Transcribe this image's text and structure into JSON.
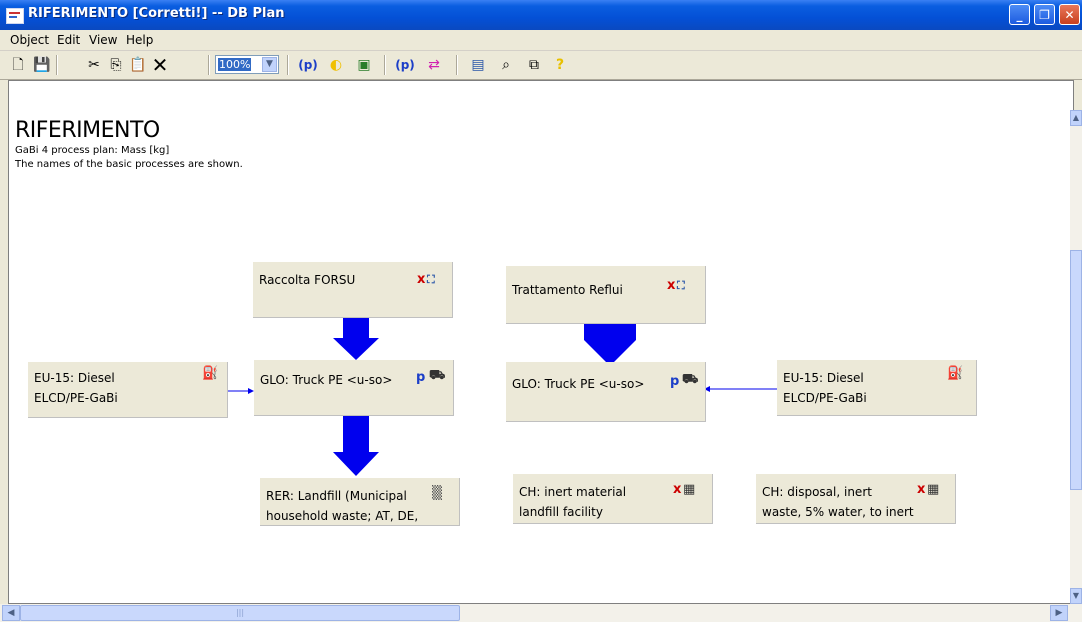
{
  "window": {
    "title": "RIFERIMENTO [Corretti!] -- DB Plan"
  },
  "menu": [
    "Object",
    "Edit",
    "View",
    "Help"
  ],
  "toolbar": {
    "zoom": "100%"
  },
  "plan": {
    "title": "RIFERIMENTO",
    "subtitle": "GaBi 4 process plan: Mass [kg]",
    "note": "The names of the basic processes are shown."
  },
  "boxes": {
    "raccolta": "Raccolta FORSU",
    "trattamento": "Trattamento Reflui",
    "diesel_left_1": "EU-15: Diesel",
    "diesel_left_2": "ELCD/PE-GaBi",
    "truck_left": "GLO: Truck PE <u-so>",
    "truck_right": "GLO: Truck PE <u-so>",
    "diesel_right_1": "EU-15: Diesel",
    "diesel_right_2": "ELCD/PE-GaBi",
    "landfill_1": "RER: Landfill (Municipal",
    "landfill_2": "household waste; AT, DE,",
    "inert_1": "CH: inert material",
    "inert_2": "landfill facility",
    "disposal_1": "CH: disposal, inert",
    "disposal_2": "waste, 5% water, to inert"
  },
  "colors": {
    "flow": "#0000ee",
    "title_bar": "#0a5ee0",
    "process_box": "#ece9d8"
  }
}
